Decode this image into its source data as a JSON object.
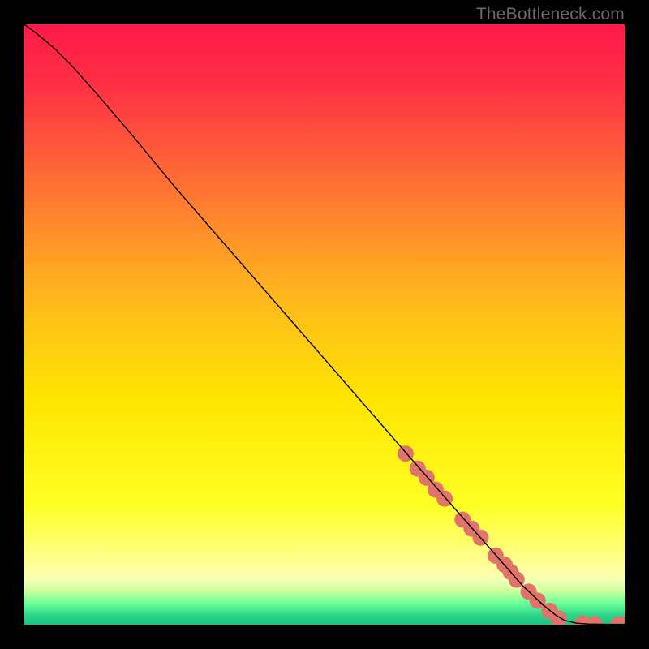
{
  "watermark": "TheBottleneck.com",
  "chart_data": {
    "type": "line",
    "title": "",
    "subtitle": "",
    "xlabel": "",
    "ylabel": "",
    "xlim": [
      0,
      100
    ],
    "ylim": [
      0,
      100
    ],
    "grid": false,
    "legend": false,
    "annotations": [],
    "background": {
      "type": "vertical-gradient",
      "description": "Red at top through orange and yellow, thin light-yellow then thin green band near the bottom",
      "stops": [
        {
          "pos": 0.0,
          "color": "#ff1a49"
        },
        {
          "pos": 0.1,
          "color": "#ff2f44"
        },
        {
          "pos": 0.25,
          "color": "#ff6a35"
        },
        {
          "pos": 0.45,
          "color": "#ffb61f"
        },
        {
          "pos": 0.62,
          "color": "#ffe400"
        },
        {
          "pos": 0.8,
          "color": "#ffff24"
        },
        {
          "pos": 0.905,
          "color": "#ffff9c"
        },
        {
          "pos": 0.925,
          "color": "#f6ffb4"
        },
        {
          "pos": 0.945,
          "color": "#c7ff9a"
        },
        {
          "pos": 0.965,
          "color": "#66ff99"
        },
        {
          "pos": 0.985,
          "color": "#2bd38a"
        },
        {
          "pos": 1.0,
          "color": "#1bc47d"
        }
      ]
    },
    "series": [
      {
        "name": "bottleneck-curve",
        "stroke": "#000000",
        "stroke_width": 1.4,
        "x": [
          0,
          2,
          5,
          8,
          12,
          18,
          25,
          35,
          45,
          55,
          65,
          72,
          78,
          83,
          86.5,
          88.5,
          90,
          92,
          94,
          97,
          100
        ],
        "y": [
          100,
          98.5,
          96,
          93,
          88.5,
          81.5,
          73,
          61.5,
          50,
          38.5,
          27,
          19,
          12.2,
          6.5,
          3.2,
          1.6,
          0.7,
          0.25,
          0.1,
          0.05,
          0.05
        ]
      }
    ],
    "marker_groups": [
      {
        "name": "highlighted-points",
        "color": "#e0736a",
        "radius": 10,
        "points": [
          {
            "x": 63.5,
            "y": 28.5
          },
          {
            "x": 65.5,
            "y": 26.0
          },
          {
            "x": 67.0,
            "y": 24.5
          },
          {
            "x": 68.5,
            "y": 22.5
          },
          {
            "x": 70.0,
            "y": 21.0
          },
          {
            "x": 73.0,
            "y": 17.5
          },
          {
            "x": 74.5,
            "y": 16.0
          },
          {
            "x": 76.0,
            "y": 14.5
          },
          {
            "x": 78.5,
            "y": 11.5
          },
          {
            "x": 80.0,
            "y": 10.0
          },
          {
            "x": 81.0,
            "y": 8.8
          },
          {
            "x": 82.0,
            "y": 7.5
          },
          {
            "x": 84.0,
            "y": 5.5
          },
          {
            "x": 85.5,
            "y": 4.0
          },
          {
            "x": 87.5,
            "y": 2.3
          },
          {
            "x": 89.0,
            "y": 1.0
          },
          {
            "x": 93.0,
            "y": 0.2
          },
          {
            "x": 95.0,
            "y": 0.1
          },
          {
            "x": 99.0,
            "y": 0.05
          },
          {
            "x": 100.0,
            "y": 0.05
          }
        ]
      }
    ]
  }
}
